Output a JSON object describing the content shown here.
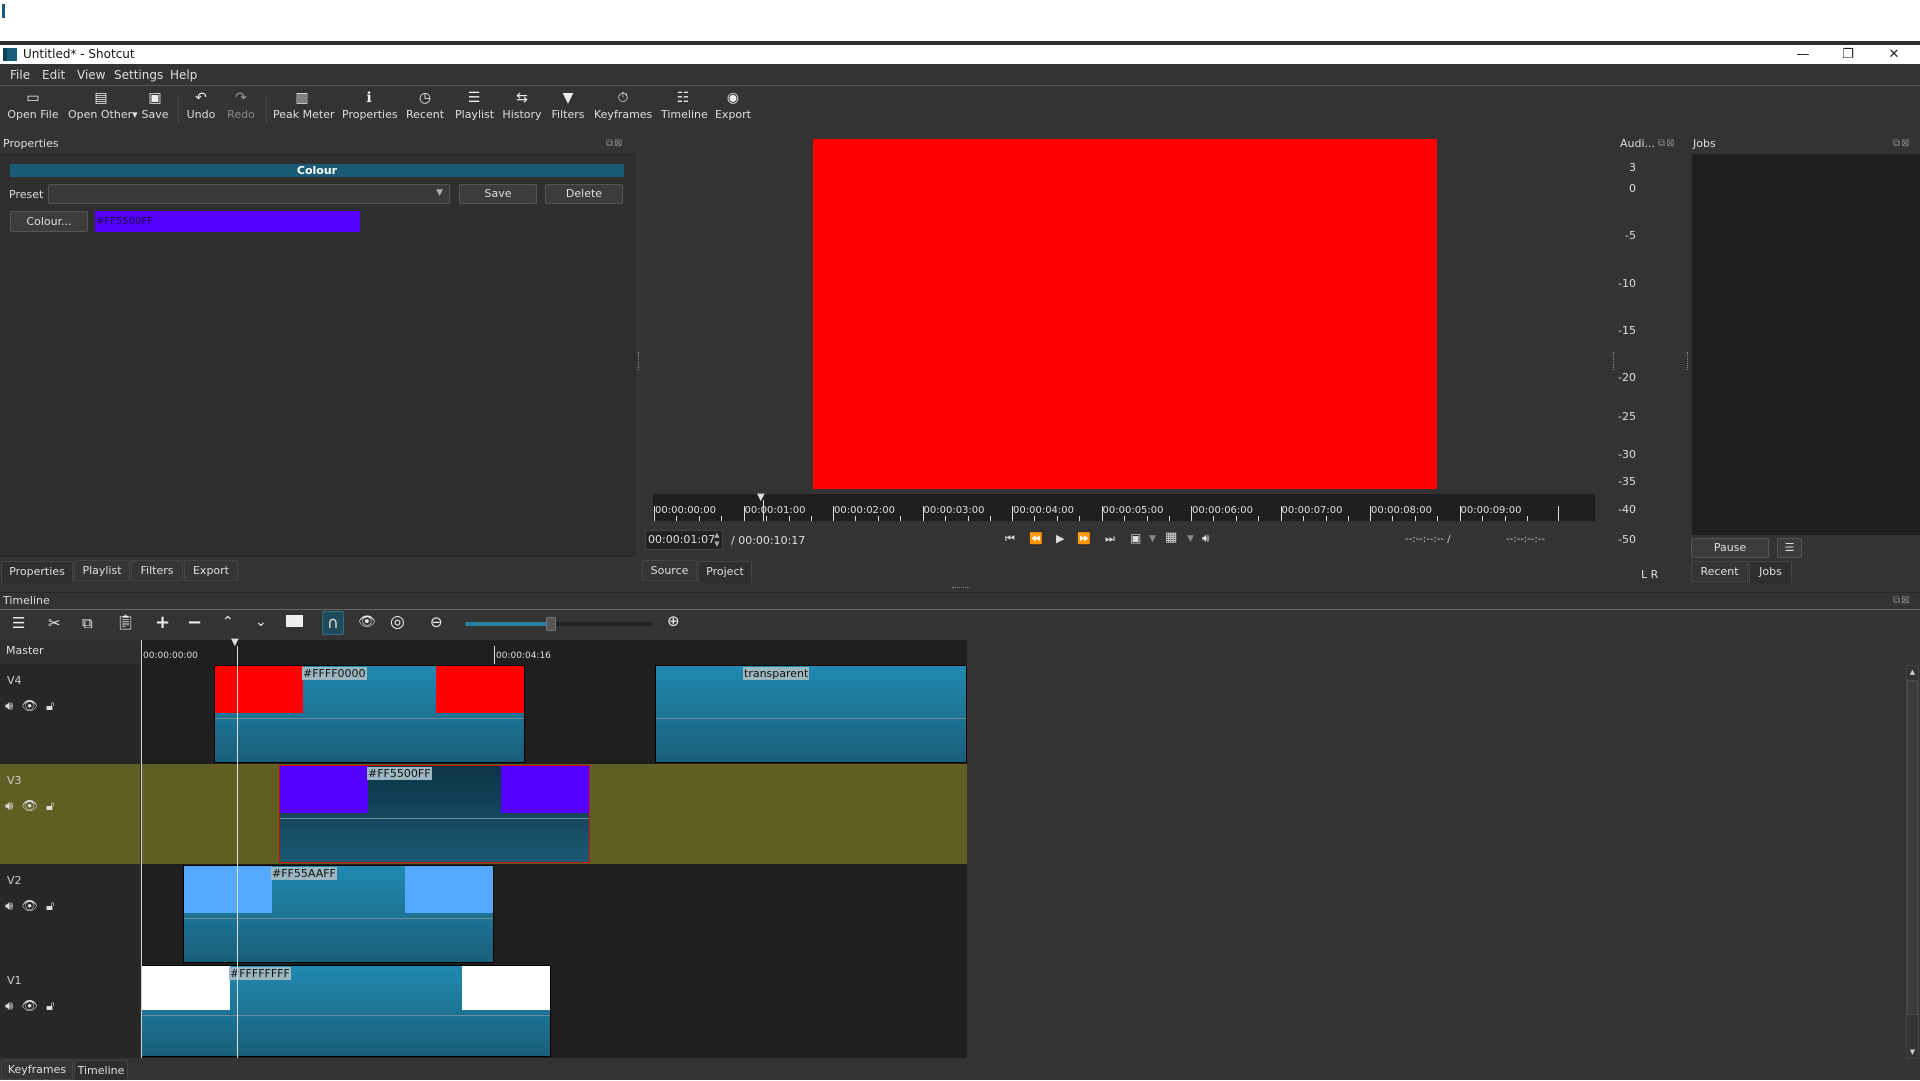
{
  "window": {
    "title": "Untitled* - Shotcut",
    "controls": {
      "minimize": "—",
      "restore": "❐",
      "close": "✕"
    }
  },
  "menu": [
    "File",
    "Edit",
    "View",
    "Settings",
    "Help"
  ],
  "toolbar": [
    {
      "id": "open-file",
      "label": "Open File",
      "icon": "folder-icon",
      "glyph": "▭",
      "enabled": true
    },
    {
      "id": "open-other",
      "label": "Open Other▾",
      "icon": "file-plus-icon",
      "glyph": "▤",
      "enabled": true
    },
    {
      "id": "save",
      "label": "Save",
      "icon": "save-icon",
      "glyph": "▣",
      "enabled": true
    },
    {
      "id": "undo",
      "label": "Undo",
      "icon": "undo-icon",
      "glyph": "↶",
      "enabled": true
    },
    {
      "id": "redo",
      "label": "Redo",
      "icon": "redo-icon",
      "glyph": "↷",
      "enabled": false
    },
    {
      "id": "peak-meter",
      "label": "Peak Meter",
      "icon": "meter-icon",
      "glyph": "▥",
      "enabled": true
    },
    {
      "id": "properties",
      "label": "Properties",
      "icon": "info-icon",
      "glyph": "ℹ",
      "enabled": true
    },
    {
      "id": "recent",
      "label": "Recent",
      "icon": "clock-icon",
      "glyph": "◷",
      "enabled": true
    },
    {
      "id": "playlist",
      "label": "Playlist",
      "icon": "list-icon",
      "glyph": "☰",
      "enabled": true
    },
    {
      "id": "history",
      "label": "History",
      "icon": "history-icon",
      "glyph": "⇆",
      "enabled": true
    },
    {
      "id": "filters",
      "label": "Filters",
      "icon": "funnel-icon",
      "glyph": "▼",
      "enabled": true
    },
    {
      "id": "keyframes",
      "label": "Keyframes",
      "icon": "stopwatch-icon",
      "glyph": "⏱",
      "enabled": true
    },
    {
      "id": "timeline",
      "label": "Timeline",
      "icon": "timeline-icon",
      "glyph": "☷",
      "enabled": true
    },
    {
      "id": "export",
      "label": "Export",
      "icon": "disc-icon",
      "glyph": "◉",
      "enabled": true
    }
  ],
  "properties": {
    "dock_title": "Properties",
    "section_title": "Colour",
    "preset_label": "Preset",
    "preset_value": "",
    "save_label": "Save",
    "delete_label": "Delete",
    "colour_button": "Colour...",
    "colour_value": "#FF5500FF",
    "colour_swatch": "#5500ff",
    "tabs": [
      "Properties",
      "Playlist",
      "Filters",
      "Export"
    ],
    "active_tab": "Properties"
  },
  "player": {
    "preview_color": "#ff0000",
    "ruler_labels": [
      "00:00:00:00",
      "00:00:01:00",
      "00:00:02:00",
      "00:00:03:00",
      "00:00:04:00",
      "00:00:05:00",
      "00:00:06:00",
      "00:00:07:00",
      "00:00:08:00",
      "00:00:09:00"
    ],
    "current_time": "00:00:01:07",
    "total_time": "/ 00:00:10:17",
    "in_point": "--:--:--:-- /",
    "out_point": "--:--:--:--",
    "tabs": [
      "Source",
      "Project"
    ],
    "active_tab": "Project"
  },
  "audio_meter": {
    "title": "Audi...",
    "scale": [
      "3",
      "0",
      "-5",
      "-10",
      "-15",
      "-20",
      "-25",
      "-30",
      "-35",
      "-40",
      "-50"
    ],
    "channels": "L  R"
  },
  "jobs": {
    "title": "Jobs",
    "pause_label": "Pause",
    "menu_glyph": "☰",
    "tabs": [
      "Recent",
      "Jobs"
    ],
    "active_tab": "Jobs"
  },
  "timeline": {
    "dock_title": "Timeline",
    "zoom_level_percent": 46,
    "master_label": "Master",
    "ruler_labels": [
      "00:00:00:00",
      "00:00:04:16"
    ],
    "tracks": [
      {
        "name": "V4",
        "selected": false,
        "clips": [
          {
            "label": "#FFFF0000",
            "color": "#ff0000",
            "selected": false
          },
          {
            "label": "transparent",
            "color": "",
            "selected": false
          }
        ]
      },
      {
        "name": "V3",
        "selected": true,
        "clips": [
          {
            "label": "#FF5500FF",
            "color": "#5500ff",
            "selected": true
          }
        ]
      },
      {
        "name": "V2",
        "selected": false,
        "clips": [
          {
            "label": "#FF55AAFF",
            "color": "#55aaff",
            "selected": false
          }
        ]
      },
      {
        "name": "V1",
        "selected": false,
        "clips": [
          {
            "label": "#FFFFFFFF",
            "color": "#ffffff",
            "selected": false
          }
        ]
      }
    ],
    "bottom_tabs": [
      "Keyframes",
      "Timeline"
    ],
    "active_bottom_tab": "Timeline"
  },
  "colors": {
    "accent": "#1a5b76",
    "selected_track": "#5f5f24",
    "selected_clip_border": "#d01010"
  }
}
